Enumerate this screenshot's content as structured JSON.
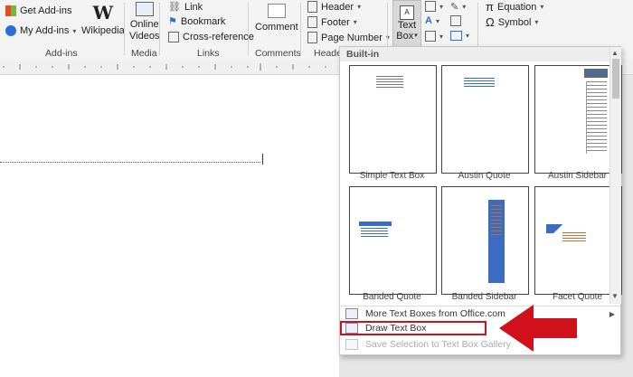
{
  "ribbon": {
    "addins": {
      "get_addins": "Get Add-ins",
      "my_addins": "My Add-ins",
      "wikipedia": "Wikipedia",
      "group": "Add-ins"
    },
    "media": {
      "online_videos_1": "Online",
      "online_videos_2": "Videos",
      "group": "Media"
    },
    "links": {
      "link": "Link",
      "bookmark": "Bookmark",
      "cross_reference": "Cross-reference",
      "group": "Links"
    },
    "comments": {
      "comment": "Comment",
      "group": "Comments"
    },
    "header_footer": {
      "header": "Header",
      "footer": "Footer",
      "page_number": "Page Number",
      "group": "Header"
    },
    "text": {
      "text_box_1": "Text",
      "text_box_2": "Box"
    },
    "symbols": {
      "equation": "Equation",
      "symbol": "Symbol"
    }
  },
  "gallery": {
    "title": "Built-in",
    "tiles": [
      {
        "label": "Simple Text Box"
      },
      {
        "label": "Austin Quote"
      },
      {
        "label": "Austin Sidebar"
      },
      {
        "label": "Banded Quote"
      },
      {
        "label": "Banded Sidebar"
      },
      {
        "label": "Facet Quote"
      }
    ],
    "menu": {
      "more": "More Text Boxes from Office.com",
      "draw": "Draw Text Box",
      "save": "Save Selection to Text Box Gallery"
    }
  },
  "colors": {
    "highlight_red": "#d0101a",
    "accent_blue": "#3b6cc4"
  }
}
